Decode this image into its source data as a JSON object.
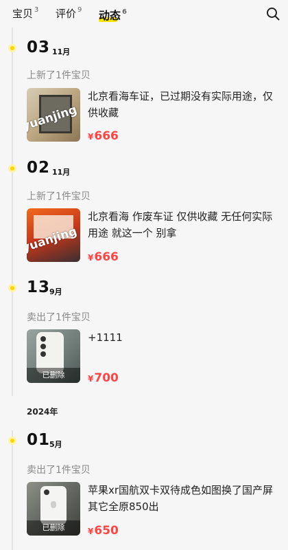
{
  "tabs": [
    {
      "label": "宝贝",
      "count": "3"
    },
    {
      "label": "评价",
      "count": "9"
    },
    {
      "label": "动态",
      "count": "6"
    }
  ],
  "colors": {
    "accent": "#ffe400",
    "price": "#ff4444",
    "timeline_dot": "#ffd600"
  },
  "icons": {
    "search": "search-icon"
  },
  "entries": [
    {
      "day": "03",
      "month": "11月",
      "action": "上新了1件宝贝",
      "desc": "北京看海车证，已过期没有实际用途，仅供收藏",
      "currency": "¥",
      "price": "666",
      "watermark": "yuanjing",
      "deleted": ""
    },
    {
      "day": "02",
      "month": "11月",
      "action": "上新了1件宝贝",
      "desc": "北京看海 作废车证 仅供收藏 无任何实际用途 就这一个 别拿",
      "currency": "¥",
      "price": "666",
      "watermark": "yuanjing",
      "deleted": ""
    },
    {
      "day": "13",
      "month": "9月",
      "action": "卖出了1件宝贝",
      "desc": "+1111",
      "currency": "¥",
      "price": "700",
      "watermark": "",
      "deleted": "已删除"
    },
    {
      "day": "01",
      "month": "5月",
      "action": "卖出了1件宝贝",
      "desc": "苹果xr国航双卡双待成色如图换了国产屏其它全原850出",
      "currency": "¥",
      "price": "650",
      "watermark": "",
      "deleted": "已删除"
    }
  ],
  "year_label": "2024年"
}
